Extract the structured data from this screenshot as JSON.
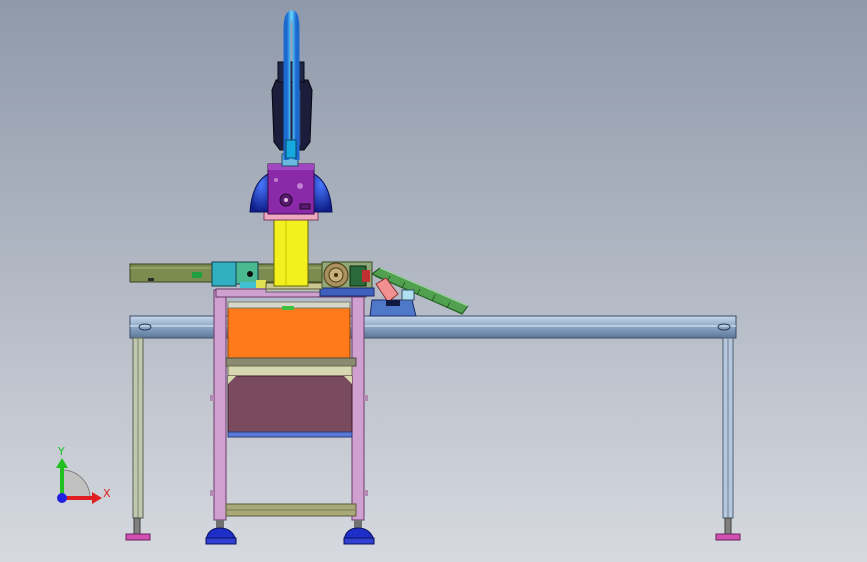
{
  "viewport": {
    "background_top": "#8f99aa",
    "background_bottom": "#d6d9df"
  },
  "triad": {
    "x_label": "X",
    "y_label": "Y",
    "x_color": "#e02020",
    "y_color": "#20c020",
    "z_color": "#2020e0"
  },
  "colors": {
    "frame_rail": "#8aa4c4",
    "frame_leg": "#c0c6b0",
    "cabinet_post": "#c090c0",
    "bin_orange": "#ff7a1a",
    "bin_maroon": "#7a4a5e",
    "conveyor_olive": "#7c8c50",
    "column_yellow": "#f2f01e",
    "motor_purple": "#8a2aa8",
    "dome_blue": "#1e3cc0",
    "motor_dark": "#1a1e3a",
    "cable_cyan": "#28a8e8",
    "foot_blue": "#1e2ec8",
    "foot_pad": "#d050b0"
  }
}
